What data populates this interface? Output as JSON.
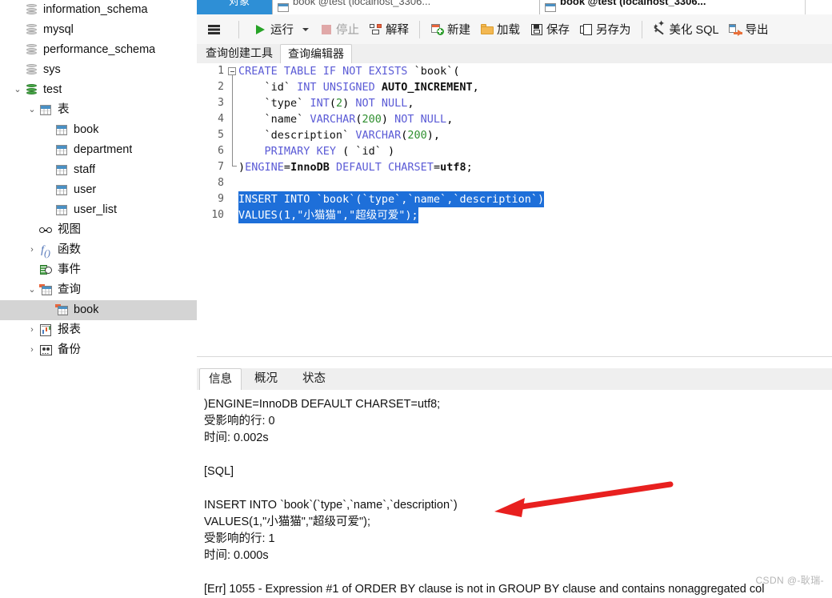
{
  "sidebar": {
    "items": [
      {
        "label": "information_schema",
        "icon": "database-icon",
        "indent": 1,
        "twisty": "",
        "selected": false,
        "state": "gray"
      },
      {
        "label": "mysql",
        "icon": "database-icon",
        "indent": 1,
        "twisty": "",
        "selected": false,
        "state": "gray"
      },
      {
        "label": "performance_schema",
        "icon": "database-icon",
        "indent": 1,
        "twisty": "",
        "selected": false,
        "state": "gray"
      },
      {
        "label": "sys",
        "icon": "database-icon",
        "indent": 1,
        "twisty": "",
        "selected": false,
        "state": "gray"
      },
      {
        "label": "test",
        "icon": "database-icon",
        "indent": 1,
        "twisty": "expanded",
        "selected": false,
        "state": "green"
      },
      {
        "label": "表",
        "icon": "table-folder-icon",
        "indent": 2,
        "twisty": "expanded",
        "selected": false,
        "state": ""
      },
      {
        "label": "book",
        "icon": "table-icon",
        "indent": 3,
        "twisty": "",
        "selected": false,
        "state": ""
      },
      {
        "label": "department",
        "icon": "table-icon",
        "indent": 3,
        "twisty": "",
        "selected": false,
        "state": ""
      },
      {
        "label": "staff",
        "icon": "table-icon",
        "indent": 3,
        "twisty": "",
        "selected": false,
        "state": ""
      },
      {
        "label": "user",
        "icon": "table-icon",
        "indent": 3,
        "twisty": "",
        "selected": false,
        "state": ""
      },
      {
        "label": "user_list",
        "icon": "table-icon",
        "indent": 3,
        "twisty": "",
        "selected": false,
        "state": ""
      },
      {
        "label": "视图",
        "icon": "view-icon",
        "indent": 2,
        "twisty": "",
        "selected": false,
        "state": ""
      },
      {
        "label": "函数",
        "icon": "function-icon",
        "indent": 2,
        "twisty": "collapsed",
        "selected": false,
        "state": ""
      },
      {
        "label": "事件",
        "icon": "event-icon",
        "indent": 2,
        "twisty": "",
        "selected": false,
        "state": ""
      },
      {
        "label": "查询",
        "icon": "query-icon",
        "indent": 2,
        "twisty": "expanded",
        "selected": false,
        "state": ""
      },
      {
        "label": "book",
        "icon": "query-icon",
        "indent": 3,
        "twisty": "",
        "selected": true,
        "state": ""
      },
      {
        "label": "报表",
        "icon": "report-icon",
        "indent": 2,
        "twisty": "collapsed",
        "selected": false,
        "state": ""
      },
      {
        "label": "备份",
        "icon": "backup-icon",
        "indent": 2,
        "twisty": "collapsed",
        "selected": false,
        "state": ""
      }
    ]
  },
  "doc_tabs": [
    {
      "label": "对象",
      "active": true,
      "icon": ""
    },
    {
      "label": "book @test (localhost_3306...",
      "active": false,
      "icon": "table-icon"
    },
    {
      "label": "book @test (localhost_3306...",
      "active": true,
      "icon": "table-icon"
    }
  ],
  "toolbar": {
    "menu_icon": "hamburger-menu-icon",
    "buttons": [
      {
        "label": "运行",
        "icon": "play-icon",
        "disabled": false,
        "dropdown": true
      },
      {
        "label": "停止",
        "icon": "stop-icon",
        "disabled": true,
        "dropdown": false
      },
      {
        "label": "解释",
        "icon": "explain-icon",
        "disabled": false,
        "dropdown": false
      },
      {
        "label": "新建",
        "icon": "new-query-icon",
        "disabled": false,
        "dropdown": false
      },
      {
        "label": "加载",
        "icon": "folder-open-icon",
        "disabled": false,
        "dropdown": false
      },
      {
        "label": "保存",
        "icon": "floppy-save-icon",
        "disabled": false,
        "dropdown": false
      },
      {
        "label": "另存为",
        "icon": "save-as-icon",
        "disabled": false,
        "dropdown": false
      },
      {
        "label": "美化 SQL",
        "icon": "beautify-sparkle-icon",
        "disabled": false,
        "dropdown": false
      },
      {
        "label": "导出",
        "icon": "export-arrow-icon",
        "disabled": false,
        "dropdown": false
      }
    ]
  },
  "sub_tabs": [
    {
      "label": "查询创建工具",
      "active": false
    },
    {
      "label": "查询编辑器",
      "active": true
    }
  ],
  "editor": {
    "line_numbers": [
      "1",
      "2",
      "3",
      "4",
      "5",
      "6",
      "7",
      "8",
      "9",
      "10"
    ],
    "lines": [
      {
        "n": 1,
        "text": "CREATE TABLE IF NOT EXISTS `book`(",
        "selected": false
      },
      {
        "n": 2,
        "text": "    `id` INT UNSIGNED AUTO_INCREMENT,",
        "selected": false
      },
      {
        "n": 3,
        "text": "    `type` INT(2) NOT NULL,",
        "selected": false
      },
      {
        "n": 4,
        "text": "    `name` VARCHAR(200) NOT NULL,",
        "selected": false
      },
      {
        "n": 5,
        "text": "    `description` VARCHAR(200),",
        "selected": false
      },
      {
        "n": 6,
        "text": "    PRIMARY KEY ( `id` )",
        "selected": false
      },
      {
        "n": 7,
        "text": ")ENGINE=InnoDB DEFAULT CHARSET=utf8;",
        "selected": false
      },
      {
        "n": 8,
        "text": "",
        "selected": false
      },
      {
        "n": 9,
        "text": "INSERT INTO `book`(`type`,`name`,`description`)",
        "selected": true
      },
      {
        "n": 10,
        "text": "VALUES(1,\"小猫猫\",\"超级可爱\");",
        "selected": true
      }
    ]
  },
  "results": {
    "tabs": [
      {
        "label": "信息",
        "active": true
      },
      {
        "label": "概况",
        "active": false
      },
      {
        "label": "状态",
        "active": false
      }
    ],
    "log_lines": [
      ")ENGINE=InnoDB DEFAULT CHARSET=utf8;",
      "受影响的行: 0",
      "时间: 0.002s",
      "",
      "[SQL]",
      "",
      "INSERT INTO `book`(`type`,`name`,`description`)",
      "VALUES(1,\"小猫猫\",\"超级可爱\");",
      "受影响的行: 1",
      "时间: 0.000s",
      "",
      "[Err] 1055 - Expression #1 of ORDER BY clause is not in GROUP BY clause and contains nonaggregated col"
    ]
  },
  "annotation": {
    "arrow_color": "#e8201f",
    "arrow_name": "red-pointer-arrow"
  },
  "watermark": {
    "text": "CSDN @-耿瑞-"
  }
}
